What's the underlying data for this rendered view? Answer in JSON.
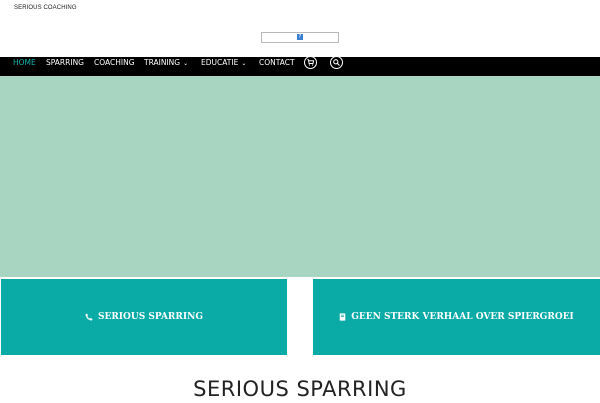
{
  "header": {
    "site_title": "SERIOUS COACHING",
    "logo_glyph": "?"
  },
  "nav": {
    "items": [
      {
        "label": "HOME",
        "active": true,
        "has_dropdown": false
      },
      {
        "label": "SPARRING",
        "active": false,
        "has_dropdown": false
      },
      {
        "label": "COACHING",
        "active": false,
        "has_dropdown": false
      },
      {
        "label": "TRAINING",
        "active": false,
        "has_dropdown": true
      },
      {
        "label": "EDUCATIE",
        "active": false,
        "has_dropdown": true
      },
      {
        "label": "CONTACT",
        "active": false,
        "has_dropdown": false
      }
    ],
    "cart_icon": "cart-icon",
    "search_icon": "search-icon",
    "active_color": "#11b5ad"
  },
  "hero": {
    "background": "#a8d5c1"
  },
  "cards": [
    {
      "label": "SERIOUS SPARRING",
      "icon": "phone-icon"
    },
    {
      "label": "GEEN STERK VERHAAL OVER SPIERGROEI",
      "icon": "book-icon"
    }
  ],
  "card_color": "#0aaba7",
  "main": {
    "heading": "SERIOUS SPARRING"
  }
}
